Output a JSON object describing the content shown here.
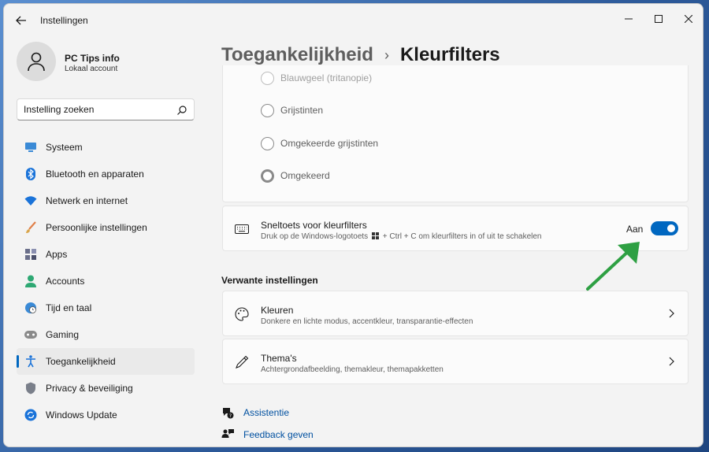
{
  "window": {
    "title": "Instellingen"
  },
  "profile": {
    "name": "PC Tips info",
    "account_type": "Lokaal account"
  },
  "search": {
    "placeholder": "Instelling zoeken"
  },
  "nav": {
    "items": [
      {
        "label": "Systeem",
        "icon": "monitor-icon"
      },
      {
        "label": "Bluetooth en apparaten",
        "icon": "bluetooth-icon"
      },
      {
        "label": "Netwerk en internet",
        "icon": "wifi-icon"
      },
      {
        "label": "Persoonlijke instellingen",
        "icon": "brush-icon"
      },
      {
        "label": "Apps",
        "icon": "apps-icon"
      },
      {
        "label": "Accounts",
        "icon": "person-icon"
      },
      {
        "label": "Tijd en taal",
        "icon": "globe-clock-icon"
      },
      {
        "label": "Gaming",
        "icon": "gamepad-icon"
      },
      {
        "label": "Toegankelijkheid",
        "icon": "accessibility-icon"
      },
      {
        "label": "Privacy & beveiliging",
        "icon": "shield-icon"
      },
      {
        "label": "Windows Update",
        "icon": "update-icon"
      }
    ],
    "active_index": 8
  },
  "breadcrumb": {
    "parent": "Toegankelijkheid",
    "separator": "›",
    "current": "Kleurfilters"
  },
  "color_filters": {
    "options": [
      {
        "label": "Blauwgeel (tritanopie)",
        "checked": false
      },
      {
        "label": "Grijstinten",
        "checked": false
      },
      {
        "label": "Omgekeerde grijstinten",
        "checked": false
      },
      {
        "label": "Omgekeerd",
        "checked": true
      }
    ]
  },
  "shortcut": {
    "title": "Sneltoets voor kleurfilters",
    "desc_before": "Druk op de Windows-logotoets",
    "desc_after": "+ Ctrl + C om kleurfilters in of uit te schakelen",
    "state_label": "Aan",
    "enabled": true
  },
  "related": {
    "heading": "Verwante instellingen",
    "items": [
      {
        "title": "Kleuren",
        "desc": "Donkere en lichte modus, accentkleur, transparantie-effecten",
        "icon": "palette-icon"
      },
      {
        "title": "Thema's",
        "desc": "Achtergrondafbeelding, themakleur, themapakketten",
        "icon": "pen-icon"
      }
    ]
  },
  "footer": {
    "help": "Assistentie",
    "feedback": "Feedback geven"
  },
  "colors": {
    "accent": "#0067c0",
    "annotation_arrow": "#2ea043"
  }
}
